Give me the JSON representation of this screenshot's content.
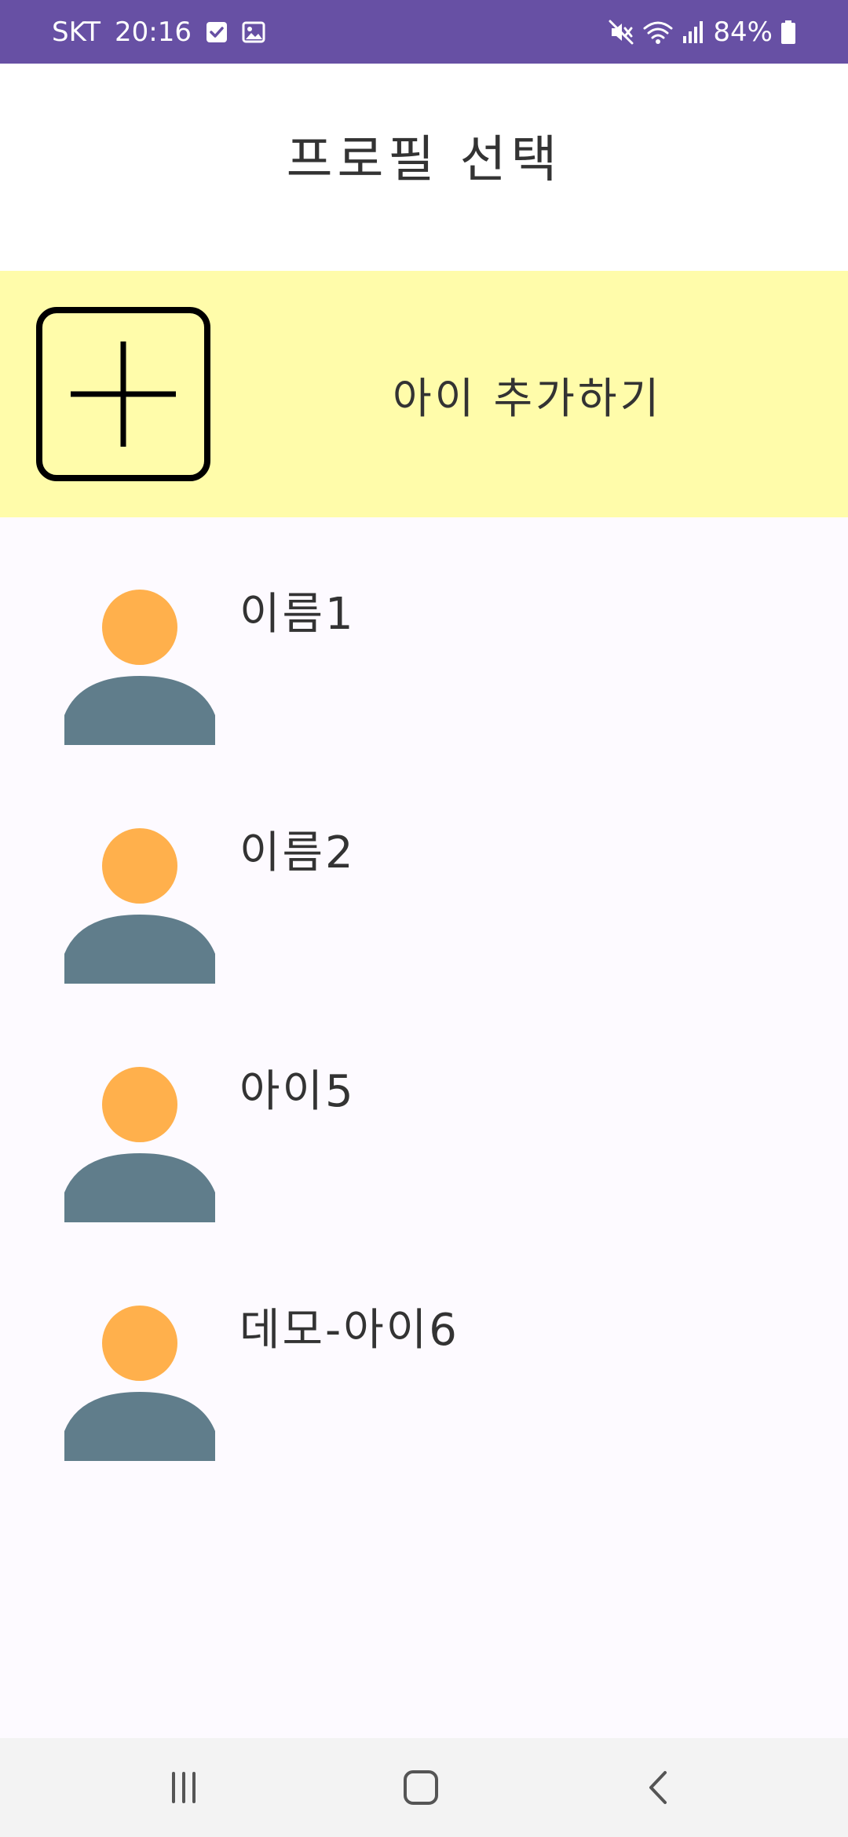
{
  "status_bar": {
    "carrier": "SKT",
    "time": "20:16",
    "battery": "84%",
    "icons": [
      "checkbox-notification-icon",
      "gallery-notification-icon",
      "mute-icon",
      "wifi-icon",
      "signal-icon",
      "battery-icon"
    ]
  },
  "header": {
    "title": "프로필 선택"
  },
  "add_child": {
    "label": "아이 추가하기",
    "icon": "add-square-icon",
    "background": "#fffcaa"
  },
  "profiles": [
    {
      "name": "이름1",
      "icon": "person-avatar-icon"
    },
    {
      "name": "이름2",
      "icon": "person-avatar-icon"
    },
    {
      "name": "아이5",
      "icon": "person-avatar-icon"
    },
    {
      "name": "데모-아이6",
      "icon": "person-avatar-icon"
    }
  ],
  "nav_bar": {
    "buttons": [
      "recent-apps-icon",
      "home-icon",
      "back-icon"
    ]
  },
  "colors": {
    "status_bar": "#6750a4",
    "avatar_head": "#ffb04c",
    "avatar_body": "#607d8b",
    "text": "#333333"
  }
}
